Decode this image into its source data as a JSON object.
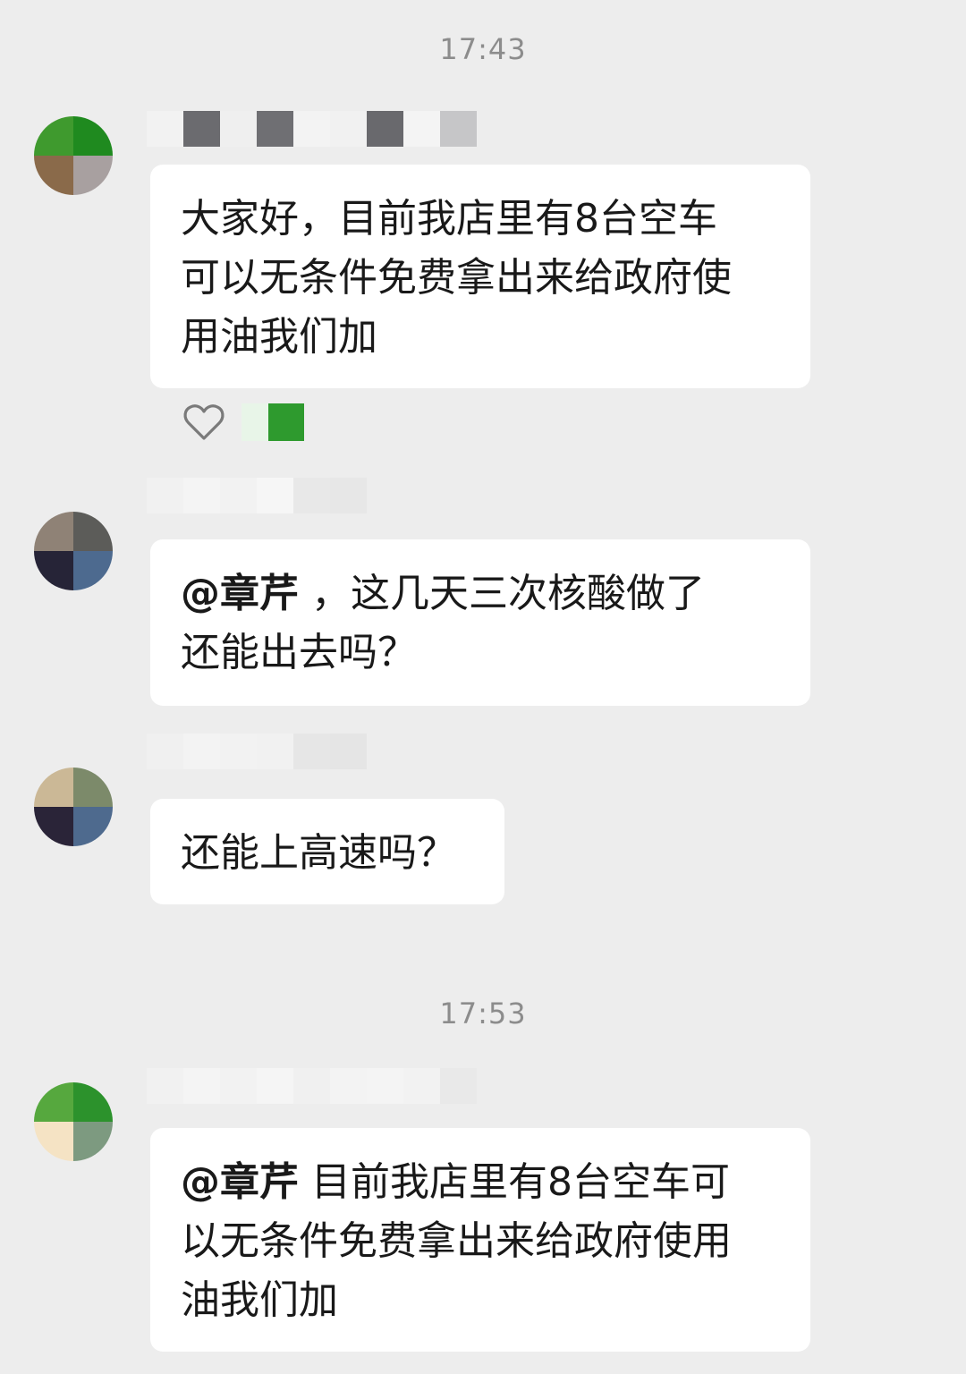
{
  "chat": {
    "timestamps": [
      "17:43",
      "17:53"
    ],
    "messages": [
      {
        "mention": "",
        "text": "大家好，目前我店里有8台空车\n可以无条件免费拿出来给政府使\n用油我们加"
      },
      {
        "mention": "@章芹",
        "text": " ，这几天三次核酸做了\n还能出去吗？"
      },
      {
        "mention": "",
        "text": "还能上高速吗？"
      },
      {
        "mention": "@章芹",
        "text": " 目前我店里有8台空车可\n以无条件免费拿出来给政府使用\n油我们加"
      }
    ],
    "reaction": {
      "icon": "heart-icon"
    }
  },
  "colors": {
    "background": "#ededed",
    "bubble": "#ffffff",
    "timestamp": "#8c8c8c",
    "text": "#191919",
    "accent_green": "#2e9a2e"
  }
}
